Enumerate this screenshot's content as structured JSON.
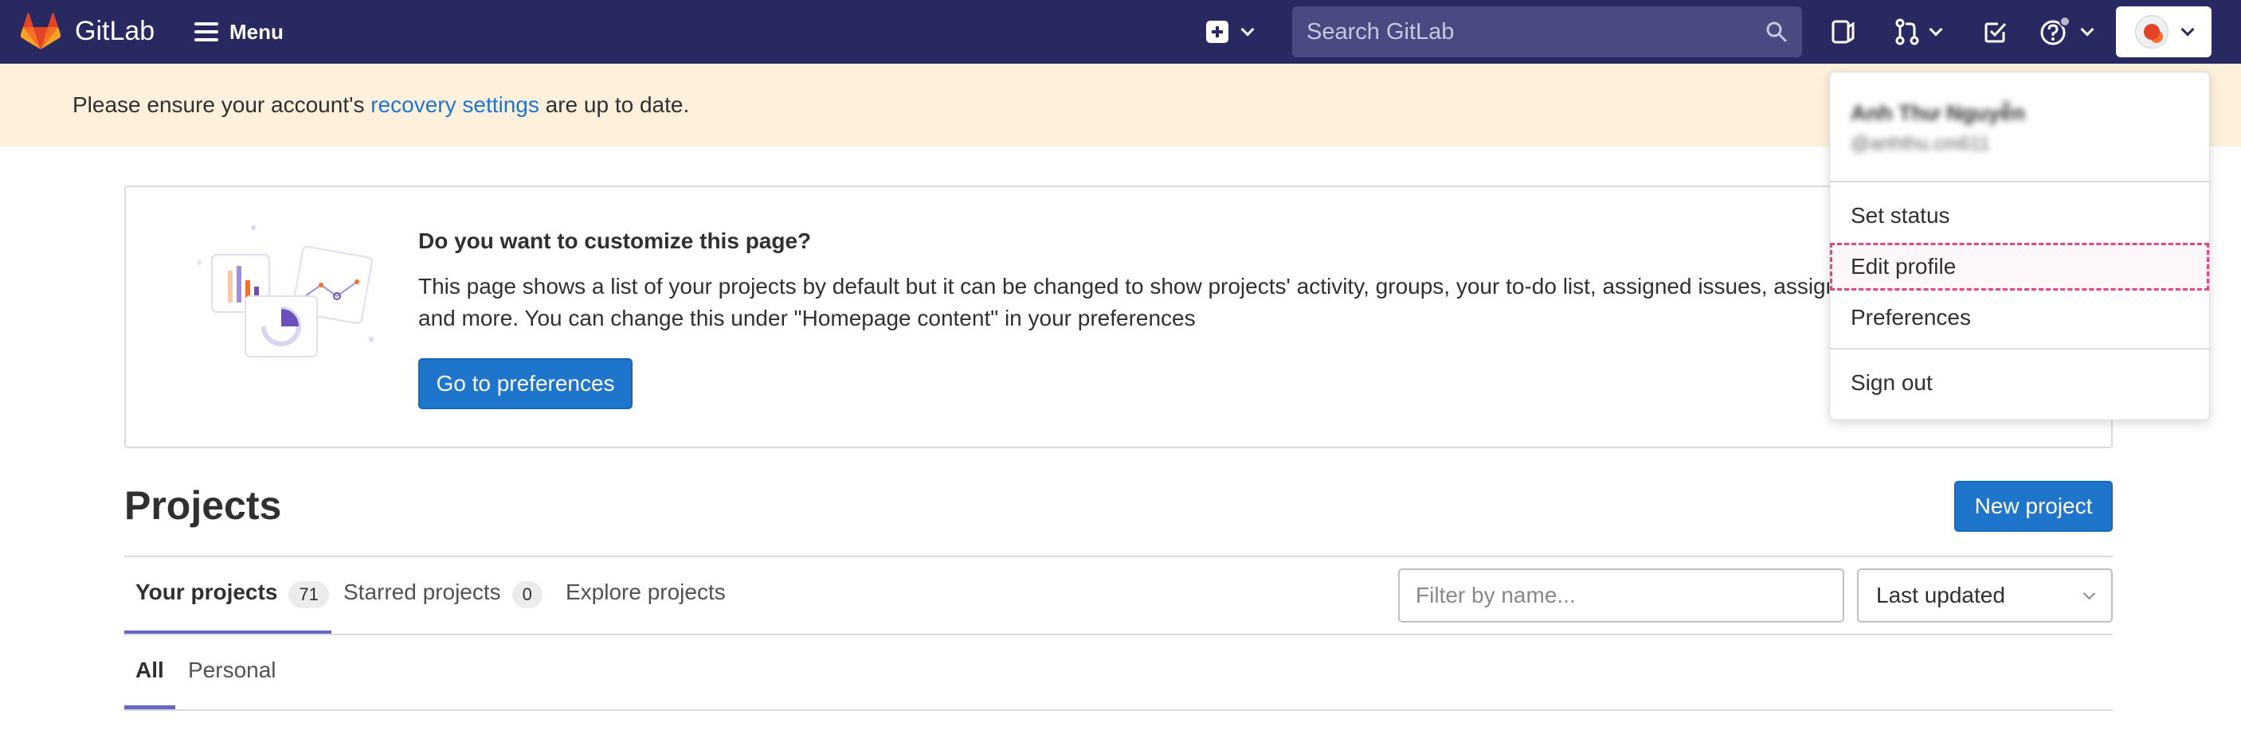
{
  "navbar": {
    "brand": "GitLab",
    "menu_label": "Menu",
    "search_placeholder": "Search GitLab",
    "colors": {
      "background": "#292961",
      "search_bg": "#4a4a83"
    },
    "icons": [
      "gitlab-logo-icon",
      "plus-square-icon",
      "chevron-down-icon",
      "search-icon",
      "issues-icon",
      "merge-request-icon",
      "todo-icon",
      "help-icon",
      "user-avatar"
    ]
  },
  "banner": {
    "prefix": "Please ensure your account's ",
    "link": "recovery settings",
    "suffix": " are up to date."
  },
  "customize_card": {
    "title": "Do you want to customize this page?",
    "text": "This page shows a list of your projects by default but it can be changed to show projects' activity, groups, your to-do list, assigned issues, assigned merge requests, and more. You can change this under \"Homepage content\" in your preferences",
    "button": "Go to preferences"
  },
  "projects": {
    "title": "Projects",
    "new_button": "New project",
    "tabs": [
      {
        "label": "Your projects",
        "count": "71",
        "active": true
      },
      {
        "label": "Starred projects",
        "count": "0",
        "active": false
      },
      {
        "label": "Explore projects",
        "active": false
      }
    ],
    "filter_placeholder": "Filter by name...",
    "sort_value": "Last updated",
    "subtabs": [
      {
        "label": "All",
        "active": true
      },
      {
        "label": "Personal",
        "active": false
      }
    ]
  },
  "user_dropdown": {
    "name": "Anh Thư Nguyễn",
    "handle": "@anhthu.cm611",
    "items": [
      "Set status",
      "Edit profile",
      "Preferences",
      "Sign out"
    ],
    "focused_item": "Edit profile"
  },
  "colors": {
    "primary": "#1f75cb",
    "tab_underline": "#6666c4",
    "banner_bg": "#fdf1dd",
    "focus_outline": "#e4457f"
  }
}
